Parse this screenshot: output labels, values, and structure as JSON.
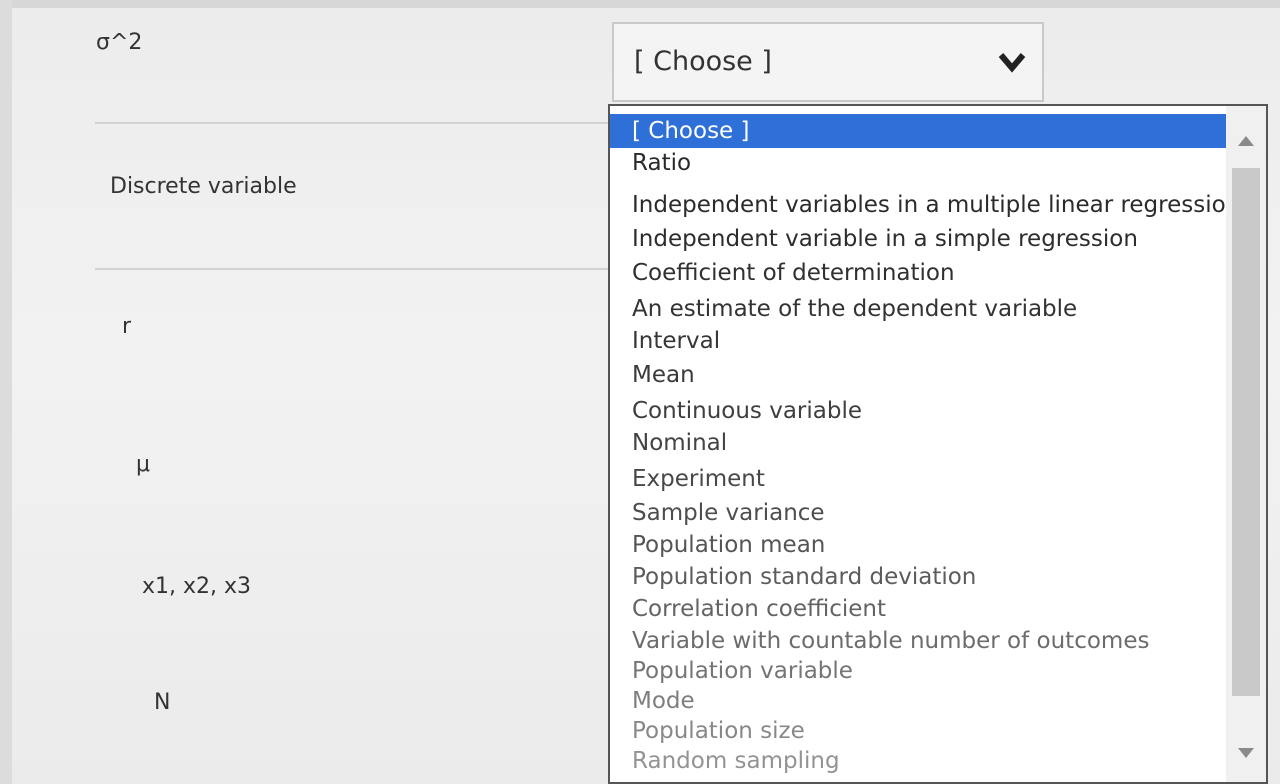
{
  "rows": [
    {
      "label": "σ^2"
    },
    {
      "label": "Discrete variable"
    },
    {
      "label": "r"
    },
    {
      "label": "μ"
    },
    {
      "label": "x1, x2, x3"
    },
    {
      "label": "N"
    }
  ],
  "select": {
    "value": "[ Choose ]",
    "icon": "chevron-down-icon"
  },
  "dropdown": {
    "options": [
      "[ Choose ]",
      "Ratio",
      "Independent variables in a multiple linear regression",
      "Independent variable in a simple regression",
      "Coefficient of determination",
      "An estimate of the dependent variable",
      "Interval",
      "Mean",
      "Continuous variable",
      "Nominal",
      "Experiment",
      "Sample variance",
      "Population mean",
      "Population standard deviation",
      "Correlation coefficient",
      "Variable with countable number of outcomes",
      "Population variable",
      "Mode",
      "Population size",
      "Random sampling"
    ],
    "selected_index": 0
  },
  "colors": {
    "highlight": "#2f6fd8",
    "text": "#222222"
  }
}
